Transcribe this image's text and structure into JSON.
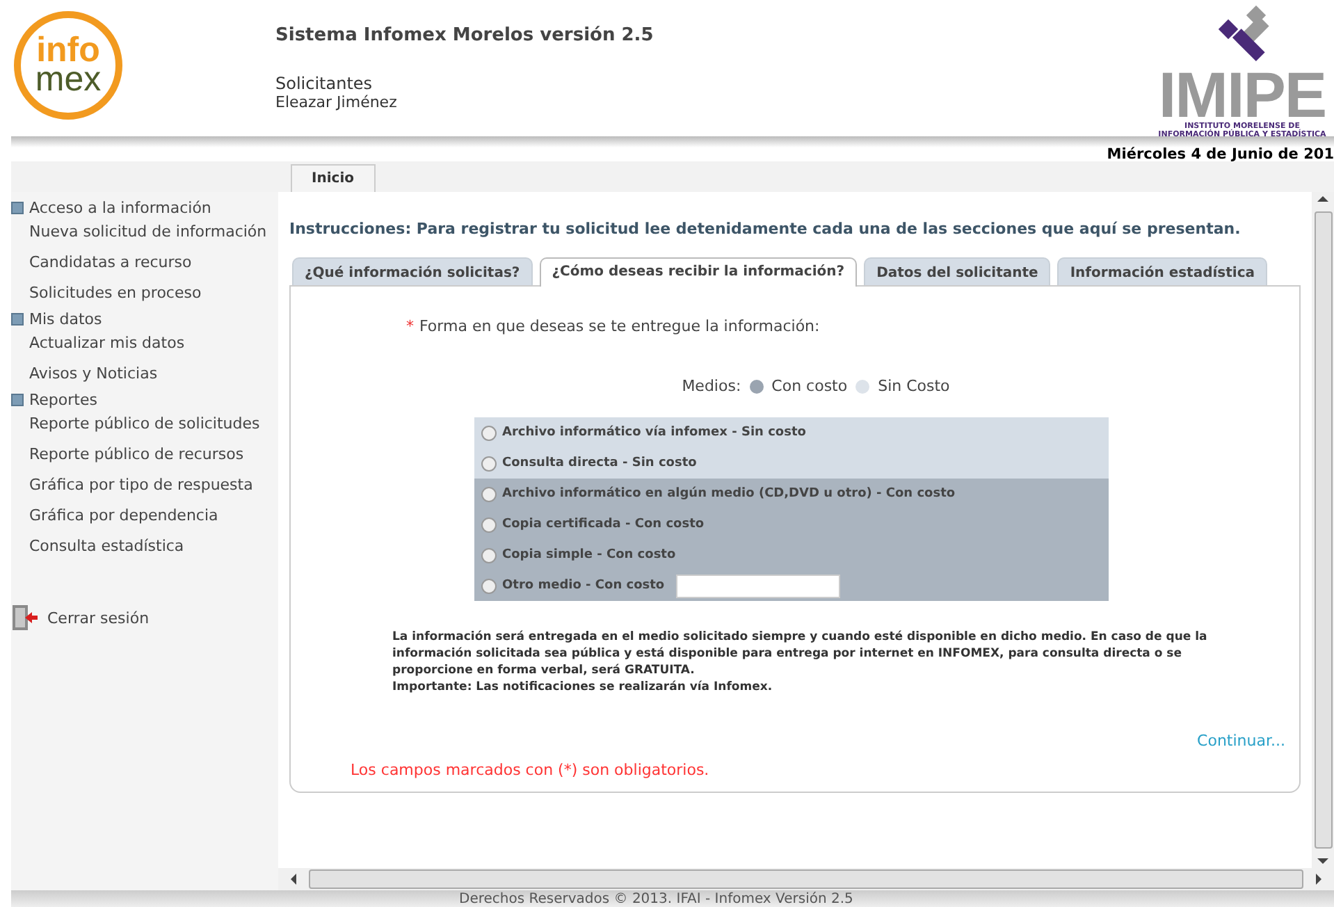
{
  "logo": {
    "line1": "info",
    "line2": "mex"
  },
  "header": {
    "title": "Sistema Infomex Morelos versión 2.5",
    "role": "Solicitantes",
    "user": "Eleazar Jiménez"
  },
  "institute_logo": {
    "name": "IMIPE",
    "subtitle_1": "INSTITUTO MORELENSE DE",
    "subtitle_2": "INFORMACIÓN PÚBLICA Y ESTADÍSTICA"
  },
  "date": "Miércoles 4 de Junio de 201",
  "top_tabs": [
    {
      "label": "Inicio"
    }
  ],
  "sidebar": {
    "groups": [
      {
        "label": "Acceso a la información",
        "children": [
          "Nueva solicitud de información",
          "Candidatas a recurso",
          "Solicitudes en proceso"
        ]
      },
      {
        "label": "Mis datos",
        "children": [
          "Actualizar mis datos",
          "Avisos y Noticias"
        ]
      },
      {
        "label": "Reportes",
        "children": [
          "Reporte público de solicitudes",
          "Reporte público de recursos",
          "Gráfica por tipo de respuesta",
          "Gráfica por dependencia",
          "Consulta estadística"
        ]
      }
    ],
    "logout": "Cerrar sesión"
  },
  "instructions": "Instrucciones: Para registrar tu solicitud lee detenidamente cada una de las secciones que aquí se presentan.",
  "form_tabs": [
    {
      "label": "¿Qué información solicitas?",
      "selected": false
    },
    {
      "label": "¿Cómo deseas recibir la información?",
      "selected": true
    },
    {
      "label": "Datos del solicitante",
      "selected": false
    },
    {
      "label": "Información estadística",
      "selected": false
    }
  ],
  "question": {
    "required_mark": "*",
    "label": "Forma en que deseas se te entregue la información:"
  },
  "medios": {
    "label": "Medios:",
    "options": [
      {
        "label": "Con costo",
        "selected": true
      },
      {
        "label": "Sin Costo",
        "selected": false
      }
    ]
  },
  "delivery_options": [
    {
      "label": "Archivo informático vía infomex - Sin costo",
      "kind": "free",
      "selected": false,
      "input": false
    },
    {
      "label": "Consulta directa - Sin costo",
      "kind": "free",
      "selected": false,
      "input": false
    },
    {
      "label": "Archivo informático en algún medio (CD,DVD u otro) - Con costo",
      "kind": "paid",
      "selected": false,
      "input": false
    },
    {
      "label": "Copia certificada - Con costo",
      "kind": "paid",
      "selected": false,
      "input": false
    },
    {
      "label": "Copia simple - Con costo",
      "kind": "paid",
      "selected": false,
      "input": false
    },
    {
      "label": "Otro medio - Con costo",
      "kind": "paid",
      "selected": false,
      "input": true
    }
  ],
  "notice": [
    "La información será entregada en el medio solicitado siempre y cuando esté disponible en dicho medio. En caso de que la información solicitada sea pública y está disponible para entrega por internet en INFOMEX, para consulta directa o se proporcione en forma verbal, será GRATUITA.",
    "Importante: Las notificaciones se realizarán vía Infomex."
  ],
  "continue_link": "Continuar...",
  "required_note": "Los campos marcados con (*) son obligatorios.",
  "footer": "Derechos Reservados © 2013. IFAI - Infomex Versión 2.5"
}
